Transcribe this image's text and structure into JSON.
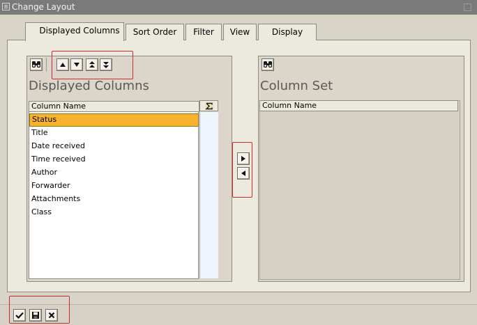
{
  "window": {
    "title": "Change Layout"
  },
  "tabs": [
    {
      "label": "Displayed Columns",
      "active": true
    },
    {
      "label": "Sort Order",
      "active": false
    },
    {
      "label": "Filter",
      "active": false
    },
    {
      "label": "View",
      "active": false
    },
    {
      "label": "Display",
      "active": false
    }
  ],
  "left_panel": {
    "heading": "Displayed Columns",
    "column_header": "Column Name",
    "sum_icon": "sigma-icon",
    "toolbar_icons": [
      "find-icon",
      "move-up-icon",
      "move-down-icon",
      "move-top-icon",
      "move-bottom-icon"
    ],
    "rows": [
      {
        "label": "Status",
        "selected": true
      },
      {
        "label": "Title",
        "selected": false
      },
      {
        "label": "Date received",
        "selected": false
      },
      {
        "label": "Time received",
        "selected": false
      },
      {
        "label": "Author",
        "selected": false
      },
      {
        "label": "Forwarder",
        "selected": false
      },
      {
        "label": "Attachments",
        "selected": false
      },
      {
        "label": "Class",
        "selected": false
      }
    ]
  },
  "right_panel": {
    "heading": "Column Set",
    "column_header": "Column Name",
    "toolbar_icons": [
      "find-icon"
    ]
  },
  "transfer_buttons": [
    "move-right-icon",
    "move-left-icon"
  ],
  "bottom_buttons": [
    "check-icon",
    "save-icon",
    "cancel-icon"
  ],
  "colors": {
    "selected_row": "#f5b32e",
    "highlight_border": "#cf2a2a",
    "title_bar": "#7a7a7a"
  }
}
